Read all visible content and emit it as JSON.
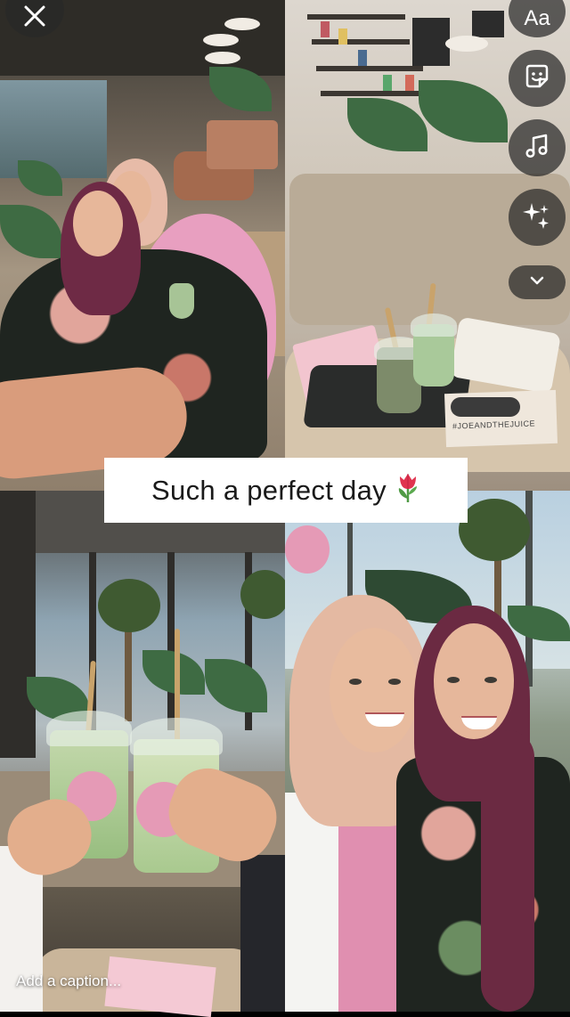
{
  "story_editor": {
    "text_tool_label": "Aa",
    "caption_placeholder": "Add a caption..."
  },
  "text_sticker": {
    "text": "Such a perfect day",
    "emoji": "tulip"
  },
  "cups": {
    "sleeve_text": "#JOEANDTHEJUICE"
  },
  "icons": {
    "close": "close-icon",
    "text": "text-icon",
    "sticker": "sticker-icon",
    "music": "music-note-icon",
    "effects": "sparkles-icon",
    "more": "chevron-down-icon"
  },
  "colors": {
    "tool_button_bg": "#282828",
    "caption_box_bg": "#ffffff",
    "caption_text": "#1a1a1a",
    "tulip_red": "#e0344f",
    "tulip_green": "#4f9a44"
  }
}
